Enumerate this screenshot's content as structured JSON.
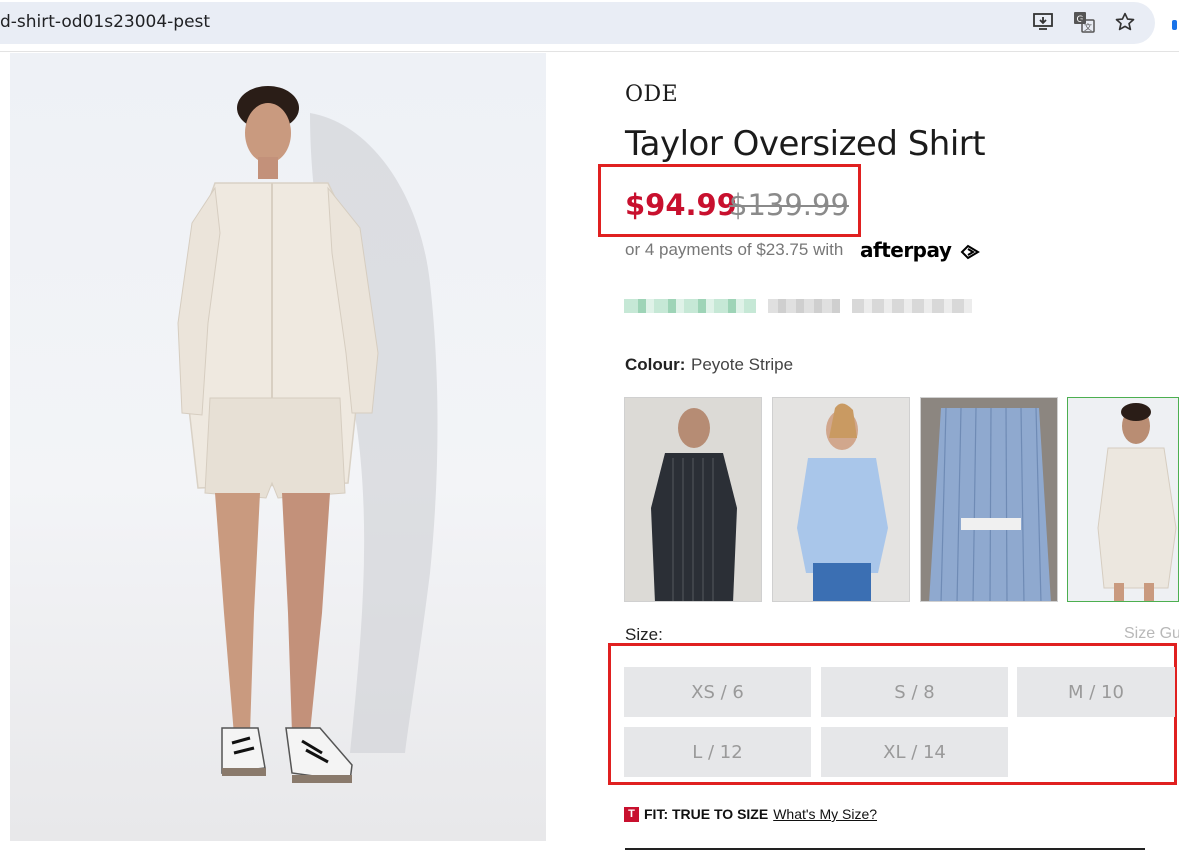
{
  "browser": {
    "url": "d-shirt-od01s23004-pest",
    "icons": [
      "install-app-icon",
      "translate-icon",
      "bookmark-star-icon"
    ]
  },
  "product": {
    "brand": "ODE",
    "title": "Taylor Oversized Shirt",
    "sale_price": "$94.99",
    "original_price": "$139.99",
    "afterpay_text": "or 4 payments of $23.75 with",
    "afterpay_logo": "afterpay",
    "colour_label": "Colour:",
    "colour_value": "Peyote Stripe",
    "swatches": [
      {
        "name": "black-stripe",
        "color": "#2b2f36"
      },
      {
        "name": "light-blue",
        "color": "#a9c6ea"
      },
      {
        "name": "blue-stripe",
        "color": "#8fa9cf"
      },
      {
        "name": "peyote-stripe",
        "color": "#ece7df",
        "selected": true
      }
    ],
    "size_label": "Size:",
    "size_guide": "Size Gu",
    "sizes": [
      "XS / 6",
      "S / 8",
      "M / 10",
      "L / 12",
      "XL / 14"
    ],
    "fit_badge": "T",
    "fit_text": "FIT: TRUE TO SIZE",
    "fit_link": "What's My Size?"
  },
  "colors": {
    "sale": "#c8102e",
    "highlight_box": "#e02020",
    "selected_swatch": "#4caf50"
  }
}
